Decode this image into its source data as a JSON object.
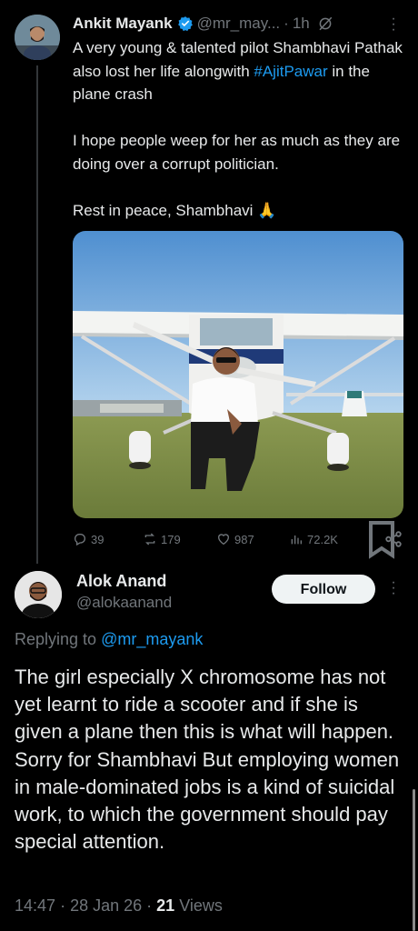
{
  "tweet": {
    "author_name": "Ankit Mayank",
    "handle": "@mr_may...",
    "separator": "·",
    "time": "1h",
    "paragraphs": [
      {
        "before": "A very young & talented pilot Shambhavi Pathak also lost her life alongwith ",
        "hashtag": "#AjitPawar",
        "after": " in the plane crash"
      },
      {
        "text": "I hope people weep for her as much as they are doing over a corrupt politician."
      },
      {
        "text": "Rest in peace, Shambhavi 🙏"
      }
    ],
    "stats": {
      "replies": "39",
      "reposts": "179",
      "likes": "987",
      "views": "72.2K"
    }
  },
  "reply": {
    "author_name": "Alok Anand",
    "handle": "@alokaanand",
    "follow_label": "Follow",
    "replying_prefix": "Replying to",
    "replying_to": "@mr_mayank",
    "text": "The girl especially X chromosome has not yet learnt to ride a scooter and if she is given a plane then this is what will happen. Sorry for Shambhavi But employing women in male-dominated jobs is a kind of suicidal work, to which the government should pay special attention.",
    "time": "14:47",
    "date": "28 Jan 26",
    "views_count": "21",
    "views_label": "Views"
  },
  "colors": {
    "background": "#000000",
    "text": "#e7e9ea",
    "muted": "#71767b",
    "accent": "#1d9bf0",
    "follow_bg": "#eff3f4"
  },
  "icons": {
    "verified": "verified-badge-icon",
    "grok": "grok-icon",
    "more": "more-dots-icon",
    "reply": "reply-icon",
    "repost": "repost-icon",
    "like": "heart-icon",
    "views": "views-icon",
    "bookmark": "bookmark-icon",
    "share": "share-icon"
  }
}
